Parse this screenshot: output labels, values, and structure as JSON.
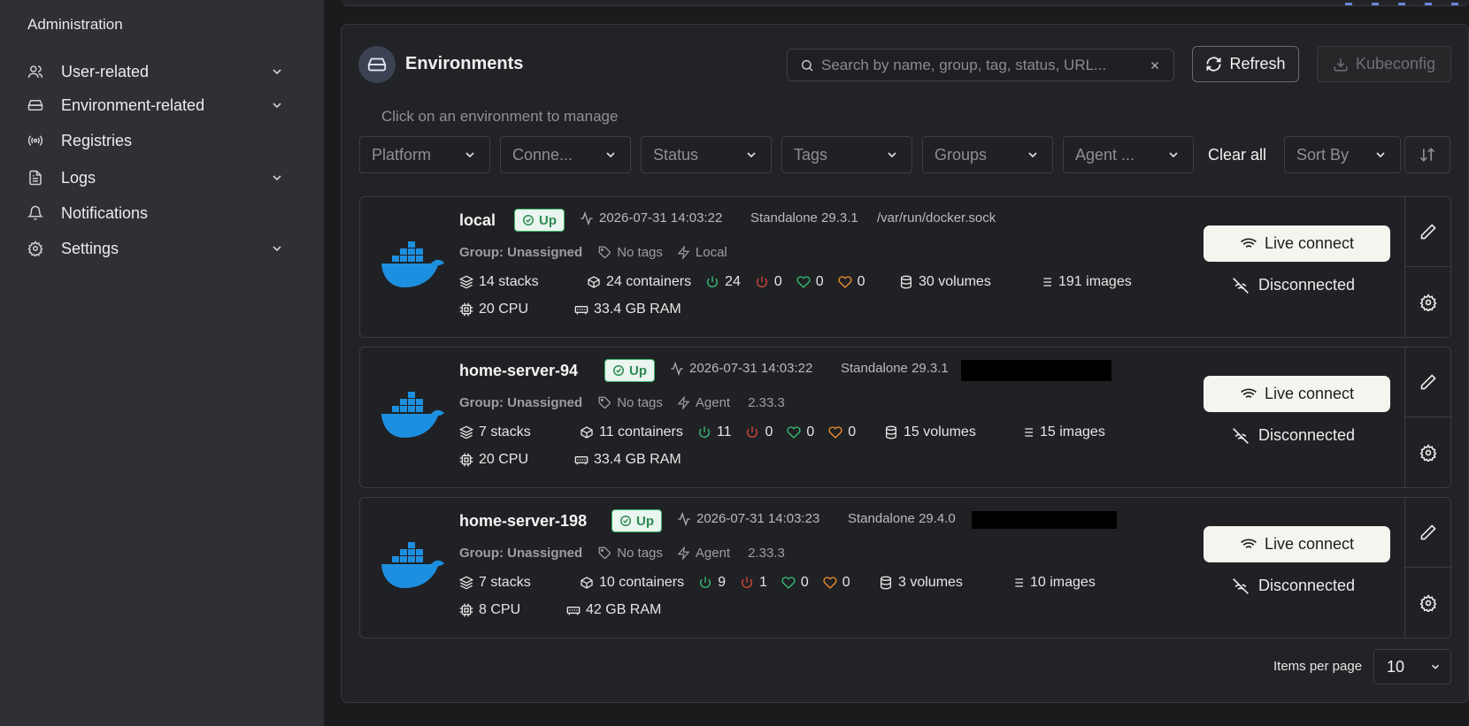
{
  "sidebar": {
    "section": "Administration",
    "items": [
      {
        "label": "User-related"
      },
      {
        "label": "Environment-related"
      },
      {
        "label": "Registries"
      },
      {
        "label": "Logs"
      },
      {
        "label": "Notifications"
      },
      {
        "label": "Settings"
      }
    ]
  },
  "panel": {
    "title": "Environments",
    "subtitle": "Click on an environment to manage",
    "search_placeholder": "Search by name, group, tag, status, URL...",
    "refresh_label": "Refresh",
    "kubeconfig_label": "Kubeconfig",
    "filters": [
      "Platform",
      "Conne...",
      "Status",
      "Tags",
      "Groups",
      "Agent ..."
    ],
    "clear_all": "Clear all",
    "sort_by": "Sort By"
  },
  "environments": [
    {
      "name": "local",
      "status": "Up",
      "heartbeat": "2026-07-31 14:03:22",
      "version": "Standalone 29.3.1",
      "url": "/var/run/docker.sock",
      "group": "Group: Unassigned",
      "tags": "No tags",
      "type": "Local",
      "agent_version": "",
      "stacks": "14 stacks",
      "containers": "24 containers",
      "running": "24",
      "stopped": "0",
      "healthy": "0",
      "unhealthy": "0",
      "volumes": "30 volumes",
      "images": "191 images",
      "cpu": "20 CPU",
      "ram": "33.4 GB RAM",
      "live_label": "Live connect",
      "conn_status": "Disconnected"
    },
    {
      "name": "home-server-94",
      "status": "Up",
      "heartbeat": "2026-07-31 14:03:22",
      "version": "Standalone 29.3.1",
      "url": "",
      "group": "Group: Unassigned",
      "tags": "No tags",
      "type": "Agent",
      "agent_version": "2.33.3",
      "stacks": "7 stacks",
      "containers": "11 containers",
      "running": "11",
      "stopped": "0",
      "healthy": "0",
      "unhealthy": "0",
      "volumes": "15 volumes",
      "images": "15 images",
      "cpu": "20 CPU",
      "ram": "33.4 GB RAM",
      "live_label": "Live connect",
      "conn_status": "Disconnected"
    },
    {
      "name": "home-server-198",
      "status": "Up",
      "heartbeat": "2026-07-31 14:03:23",
      "version": "Standalone 29.4.0",
      "url": "",
      "group": "Group: Unassigned",
      "tags": "No tags",
      "type": "Agent",
      "agent_version": "2.33.3",
      "stacks": "7 stacks",
      "containers": "10 containers",
      "running": "9",
      "stopped": "1",
      "healthy": "0",
      "unhealthy": "0",
      "volumes": "3 volumes",
      "images": "10 images",
      "cpu": "8 CPU",
      "ram": "42 GB RAM",
      "live_label": "Live connect",
      "conn_status": "Disconnected"
    }
  ],
  "pagination": {
    "label": "Items per page",
    "value": "10"
  },
  "colors": {
    "accent_green": "#36c177",
    "danger": "#d8453b",
    "warning": "#f0922b",
    "docker_blue": "#1d8fe0"
  }
}
